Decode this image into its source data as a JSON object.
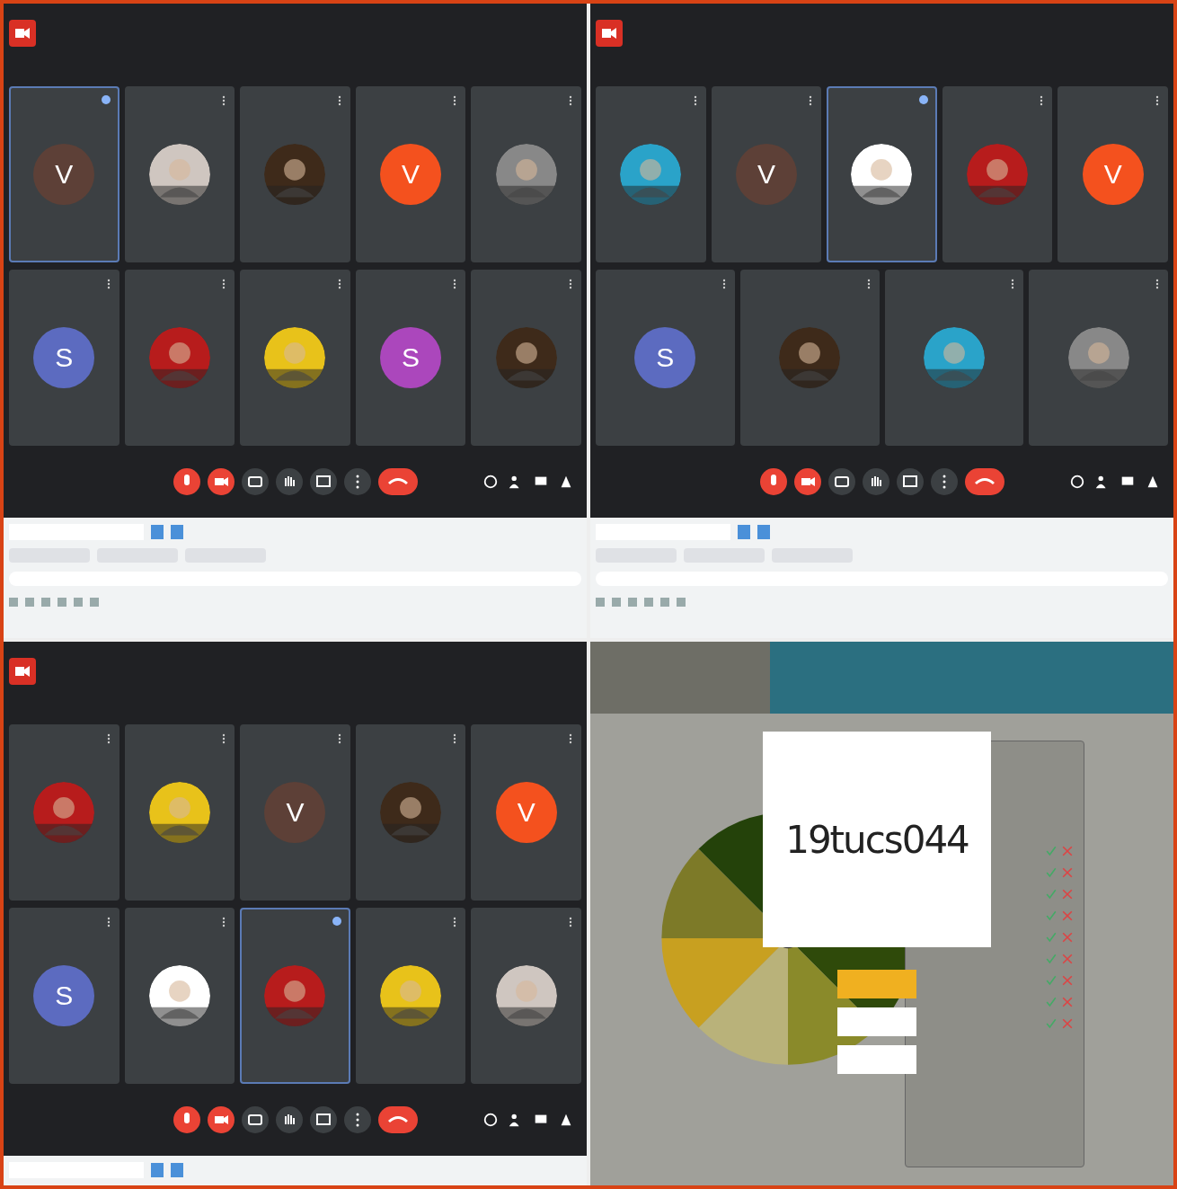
{
  "panes": [
    {
      "kind": "meeting",
      "rows": [
        [
          {
            "kind": "letter",
            "letter": "V",
            "color": "#5d4037",
            "selected": true
          },
          {
            "kind": "picture",
            "selected": false
          },
          {
            "kind": "picture",
            "selected": false
          },
          {
            "kind": "letter",
            "letter": "V",
            "color": "#f4511e",
            "selected": false
          },
          {
            "kind": "picture",
            "selected": false
          }
        ],
        [
          {
            "kind": "letter",
            "letter": "S",
            "color": "#5c6bc0",
            "selected": false
          },
          {
            "kind": "picture",
            "selected": false
          },
          {
            "kind": "picture",
            "selected": false
          },
          {
            "kind": "letter",
            "letter": "S",
            "color": "#ab47bc",
            "selected": false
          },
          {
            "kind": "picture",
            "selected": false
          }
        ]
      ]
    },
    {
      "kind": "meeting",
      "rows": [
        [
          {
            "kind": "picture",
            "selected": false
          },
          {
            "kind": "letter",
            "letter": "V",
            "color": "#5d4037",
            "selected": false
          },
          {
            "kind": "picture",
            "selected": true
          },
          {
            "kind": "picture",
            "selected": false
          },
          {
            "kind": "letter",
            "letter": "V",
            "color": "#f4511e",
            "selected": false
          }
        ],
        [
          {
            "kind": "letter",
            "letter": "S",
            "color": "#5c6bc0",
            "selected": false
          },
          {
            "kind": "picture",
            "selected": false
          },
          {
            "kind": "picture",
            "selected": false
          },
          {
            "kind": "picture",
            "selected": false
          }
        ]
      ]
    },
    {
      "kind": "meeting",
      "rows": [
        [
          {
            "kind": "picture",
            "selected": false
          },
          {
            "kind": "picture",
            "selected": false
          },
          {
            "kind": "letter",
            "letter": "V",
            "color": "#5d4037",
            "selected": false
          },
          {
            "kind": "picture",
            "selected": false
          },
          {
            "kind": "letter",
            "letter": "V",
            "color": "#f4511e",
            "selected": false
          }
        ],
        [
          {
            "kind": "letter",
            "letter": "S",
            "color": "#5c6bc0",
            "selected": false
          },
          {
            "kind": "picture",
            "selected": false
          },
          {
            "kind": "picture",
            "selected": true
          },
          {
            "kind": "picture",
            "selected": false
          },
          {
            "kind": "picture",
            "selected": false
          }
        ]
      ]
    },
    {
      "kind": "wheel",
      "winner": "19tucs044"
    }
  ]
}
